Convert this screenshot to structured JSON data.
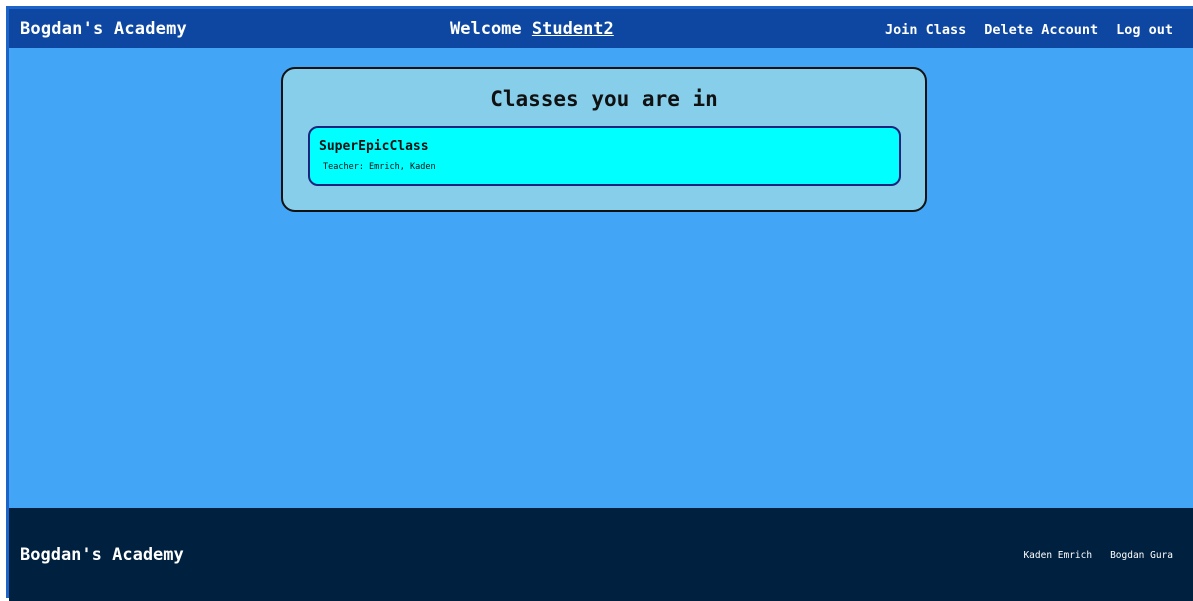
{
  "header": {
    "brand": "Bogdan's Academy",
    "welcome_prefix": "Welcome ",
    "username": "Student2",
    "nav": {
      "join_class": "Join Class",
      "delete_account": "Delete Account",
      "log_out": "Log out"
    }
  },
  "main": {
    "panel_title": "Classes you are in",
    "classes": [
      {
        "name": "SuperEpicClass",
        "teacher": "Teacher: Emrich, Kaden"
      }
    ]
  },
  "footer": {
    "brand": "Bogdan's Academy",
    "links": [
      "Kaden Emrich",
      "Bogdan Gura"
    ]
  },
  "colors": {
    "page_background": "#42a5f5",
    "header_background": "#0d47a1",
    "panel_background": "#87ceeb",
    "card_background": "#00ffff",
    "footer_background": "#00203f"
  }
}
